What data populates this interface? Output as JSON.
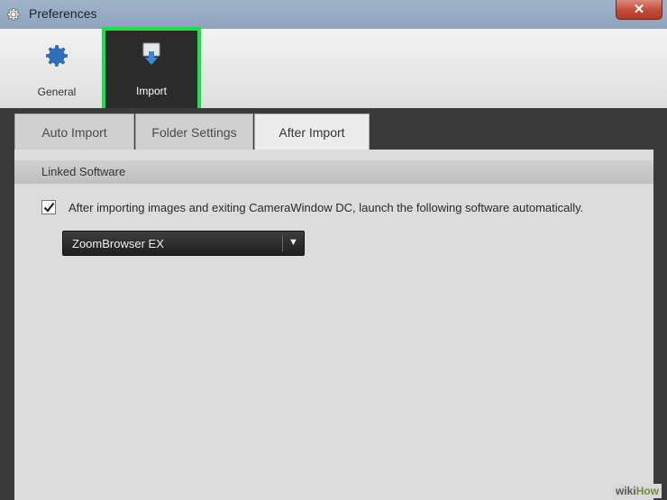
{
  "window": {
    "title": "Preferences",
    "close_symbol": "✕"
  },
  "toolbar": {
    "items": [
      {
        "label": "General",
        "icon": "gear-icon"
      },
      {
        "label": "Import",
        "icon": "import-icon",
        "selected": true
      }
    ]
  },
  "tabs": [
    {
      "label": "Auto Import"
    },
    {
      "label": "Folder Settings"
    },
    {
      "label": "After Import",
      "active": true
    }
  ],
  "section": {
    "title": "Linked Software"
  },
  "options": {
    "launch_software_checkbox": {
      "checked": true,
      "label": "After importing images and exiting CameraWindow DC, launch the following software automatically."
    },
    "software_select": {
      "value": "ZoomBrowser EX",
      "arrow": "▼"
    }
  },
  "watermark": {
    "prefix": "wiki",
    "suffix": "How"
  },
  "colors": {
    "highlight": "#19e14a",
    "close": "#c44a38",
    "accent": "#2f6fb7"
  }
}
